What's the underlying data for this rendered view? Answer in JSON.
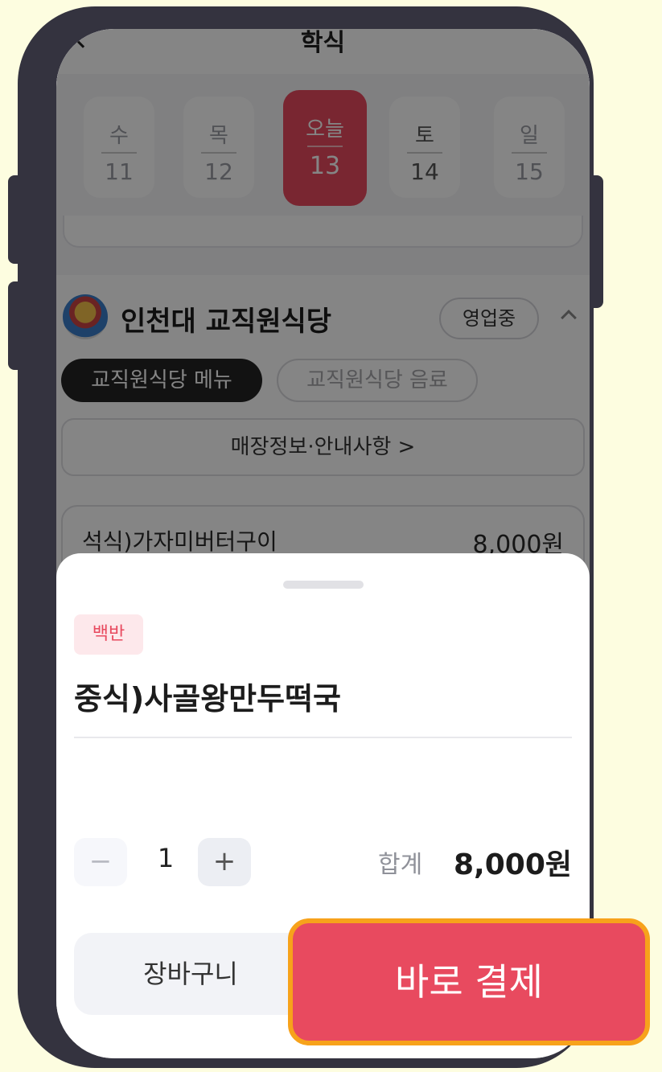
{
  "header": {
    "title": "학식"
  },
  "dates": [
    {
      "weekday": "수",
      "day": "11"
    },
    {
      "weekday": "목",
      "day": "12"
    },
    {
      "weekday": "오늘",
      "day": "13"
    },
    {
      "weekday": "토",
      "day": "14"
    },
    {
      "weekday": "일",
      "day": "15"
    }
  ],
  "restaurant": {
    "name": "인천대 교직원식당",
    "status": "영업중"
  },
  "tabs": [
    {
      "label": "교직원식당 메뉴"
    },
    {
      "label": "교직원식당 음료"
    }
  ],
  "info_button": {
    "label": "매장정보·안내사항 >"
  },
  "menu_preview": {
    "name": "석식)가자미버터구이",
    "price": "8,000원"
  },
  "sheet": {
    "badge": "백반",
    "item_title": "중식)사골왕만두떡국",
    "quantity": "1",
    "minus_symbol": "−",
    "plus_symbol": "+",
    "total_label": "합계",
    "total_value": "8,000원",
    "cart_label": "장바구니",
    "pay_label": "바로 결제"
  },
  "colors": {
    "accent": "#e84a5f",
    "pay_border": "#f7a21b",
    "frame": "#34333f",
    "background": "#fdfde0"
  }
}
